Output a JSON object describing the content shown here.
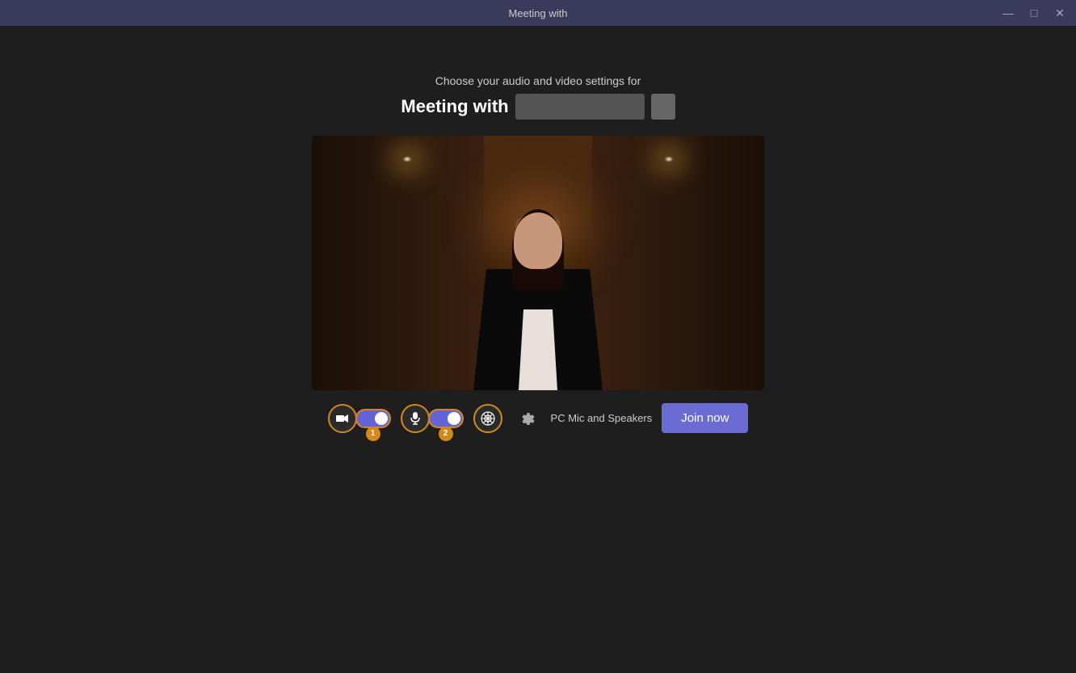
{
  "titleBar": {
    "title": "Meeting with",
    "minimizeLabel": "minimize",
    "maximizeLabel": "maximize",
    "closeLabel": "close"
  },
  "header": {
    "subtitle": "Choose your audio and video settings for",
    "meetingTitle": "Meeting with"
  },
  "controls": {
    "cameraIcon": "📹",
    "micIcon": "🎤",
    "effectsIcon": "✳",
    "settingsIcon": "⚙",
    "audioLabel": "PC Mic and Speakers",
    "joinLabel": "Join now",
    "badge1": "1",
    "badge2": "2"
  }
}
